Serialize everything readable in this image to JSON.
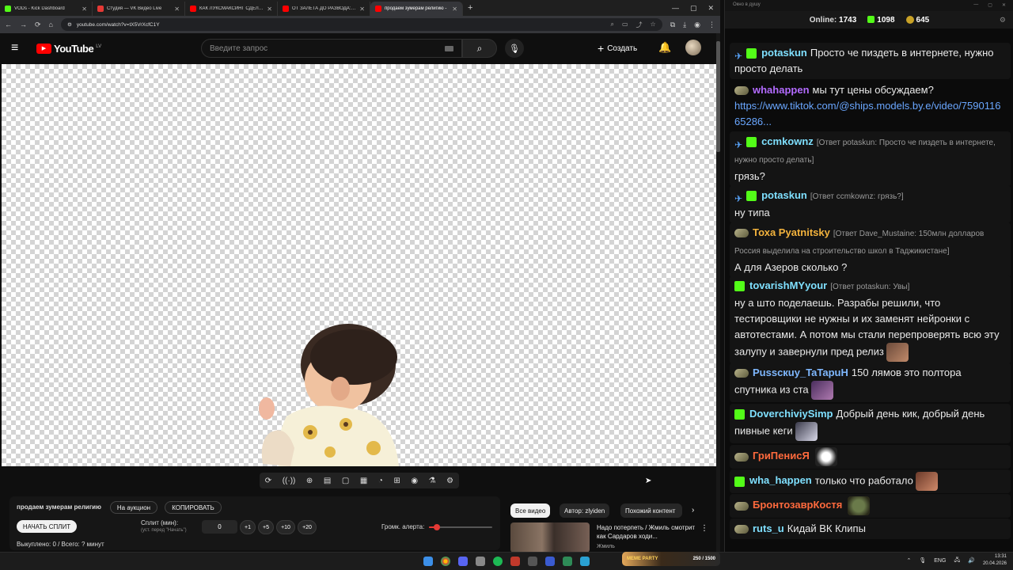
{
  "browser": {
    "tabs": [
      {
        "title": "VODs - Kick Dashboard",
        "color": "#53fc18"
      },
      {
        "title": "Студия — VK Видео Live",
        "color": "#e53935"
      },
      {
        "title": "КАК ЛУКСМАКСИНГ СДЕЛАЛ ...",
        "color": "#ff0000"
      },
      {
        "title": "ОТ ЗАЛЕТА ДО РАЗВОДА: по...",
        "color": "#ff0000"
      },
      {
        "title": "продаем зумерам религию -",
        "color": "#ff0000",
        "active": true
      }
    ],
    "new_tab": "+",
    "url": "youtube.com/watch?v=tX5VrXcfC1Y"
  },
  "youtube": {
    "logo_word": "YouTube",
    "country_code": "LV",
    "search_placeholder": "Введите запрос",
    "create_label": "Создать"
  },
  "video_tools": [
    "⟳",
    "((·))",
    "⊕",
    "▤",
    "▢",
    "▦",
    "◔",
    "⊞",
    "◉",
    "⚗",
    "⚙"
  ],
  "split_panel": {
    "video_title": "продаем зумерам религию",
    "auction_label": "На аукцион",
    "copy_label": "КОПИРОВАТЬ",
    "start_split_label": "НАЧАТЬ СПЛИТ",
    "split_label": "Сплит (мин):",
    "split_hint": "(уст. перед \"Начать\")",
    "split_value": "0",
    "increments": [
      "+1",
      "+5",
      "+10",
      "+20"
    ],
    "alert_volume_label": "Громк. алерта:",
    "alert_volume": 0.12,
    "bought_text": "Выкуплено: 0 / Всего: ? минут"
  },
  "related": {
    "chips": [
      "Все видео",
      "Автор: zlyiden",
      "Похожий контент"
    ],
    "active_chip": 0,
    "video_title": "Надо потерпеть / Жмиль смотрит как Сардаров ходи...",
    "channel": "Жмиль"
  },
  "chat": {
    "window_title": "Окно в душу",
    "online_label": "Online:",
    "online_count": "1743",
    "kick_count": "1098",
    "coin_count": "645",
    "messages": [
      {
        "user": "potaskun",
        "color": "#7fe0ff",
        "badges": [
          "mod",
          "k"
        ],
        "reply": "",
        "text": "Просто че пиздеть в интернете, нужно просто делать"
      },
      {
        "user": "whahappen",
        "color": "#b36bff",
        "badges": [
          "sub"
        ],
        "reply": "",
        "text": "мы тут цены обсуждаем?",
        "link": "https://www.tiktok.com/@ships.models.by.e/video/759011665286..."
      },
      {
        "user": "ccmkownz",
        "color": "#7fe0ff",
        "badges": [
          "mod",
          "k"
        ],
        "reply": "[Ответ potaskun: Просто че пиздеть в интернете, нужно просто делать]",
        "text": "грязь?"
      },
      {
        "user": "potaskun",
        "color": "#7fe0ff",
        "badges": [
          "mod",
          "k"
        ],
        "reply": "[Ответ ccmkownz: грязь?]",
        "text": "ну типа"
      },
      {
        "user": "Тоха Pyatnitsky",
        "color": "#f3b33d",
        "badges": [
          "sub"
        ],
        "reply": "[Ответ Dave_Mustaine: 150млн долларов Россия выделила на строительство школ в Таджикистане]",
        "text": "А для Азеров сколько ?"
      },
      {
        "user": "tovarishMYyour",
        "color": "#7fe0ff",
        "badges": [
          "k"
        ],
        "reply": "[Ответ potaskun: Увы]",
        "text": "ну а што поделаешь. Разрабы решили, что тестировщики не нужны и их заменят нейронки с автотестами. А потом мы стали перепроверять всю эту залупу и завернули пред релиз"
      },
      {
        "user": "Pusscкuy_TaTapuH",
        "color": "#7fb8ff",
        "badges": [
          "sub"
        ],
        "reply": "",
        "text": "150 лямов это полтора спутника из ста"
      },
      {
        "user": "DoverchiviySimp",
        "color": "#7fe0ff",
        "badges": [
          "k"
        ],
        "reply": "",
        "text": "Добрый день кик, добрый день пивные кеги"
      },
      {
        "user": "ГриПенисЯ",
        "color": "#ff6a3d",
        "badges": [
          "sub"
        ],
        "reply": "",
        "text": ""
      },
      {
        "user": "wha_happen",
        "color": "#7fe0ff",
        "badges": [
          "k"
        ],
        "reply": "",
        "text": "только что работало"
      },
      {
        "user": "БронтозаврКостя",
        "color": "#ff6a3d",
        "badges": [
          "sub"
        ],
        "reply": "",
        "text": ""
      },
      {
        "user": "ruts_u",
        "color": "#7fe0ff",
        "badges": [
          "sub"
        ],
        "reply": "",
        "text": "Кидай ВК Клипы"
      }
    ]
  },
  "taskbar": {
    "banner_title": "MEME PARTY",
    "banner_progress": "250 / 1500",
    "lang": "ENG",
    "time": "13:31",
    "date": "20.04.2026"
  }
}
